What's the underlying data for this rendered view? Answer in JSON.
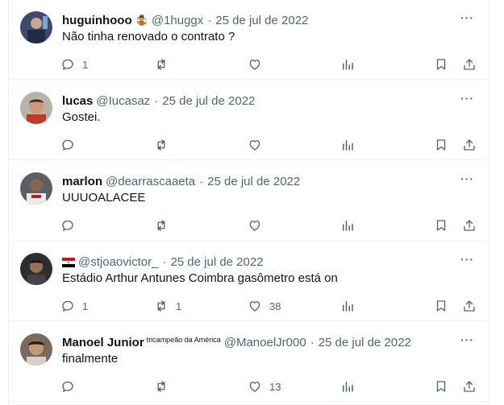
{
  "tweets": [
    {
      "name": "huguinhooo",
      "emoji": "🤹",
      "handle": "@1huggx",
      "date": "25 de jul de 2022",
      "text": "Não tinha renovado o contrato ?",
      "replies": "1",
      "retweets": "",
      "likes": "",
      "views": ""
    },
    {
      "name": "lucas",
      "handle": "@Iucasaz",
      "date": "25 de jul de 2022",
      "text": "Gostei.",
      "replies": "",
      "retweets": "",
      "likes": "",
      "views": ""
    },
    {
      "name": "marlon",
      "handle": "@dearrascaaeta",
      "date": "25 de jul de 2022",
      "text": "UUUOALACEE",
      "replies": "",
      "retweets": "",
      "likes": "",
      "views": ""
    },
    {
      "name": "",
      "handle": "@stjoaovictor_",
      "date": "25 de jul de 2022",
      "text": "Estádio Arthur Antunes Coimbra gasômetro está on",
      "replies": "1",
      "retweets": "1",
      "likes": "38",
      "views": ""
    },
    {
      "name": "Manoel Junior",
      "name_badge": "tricampeão da América",
      "handle": "@ManoelJr000",
      "date": "25 de jul de 2022",
      "text": "finalmente",
      "replies": "",
      "retweets": "",
      "likes": "13",
      "views": ""
    }
  ],
  "separator": "·",
  "more": "···",
  "colors": {
    "text": "#0f1419",
    "muted": "#536471",
    "border": "#eff3f4"
  },
  "icons": [
    "reply-icon",
    "retweet-icon",
    "like-icon",
    "views-icon",
    "bookmark-icon",
    "share-icon",
    "more-icon"
  ]
}
